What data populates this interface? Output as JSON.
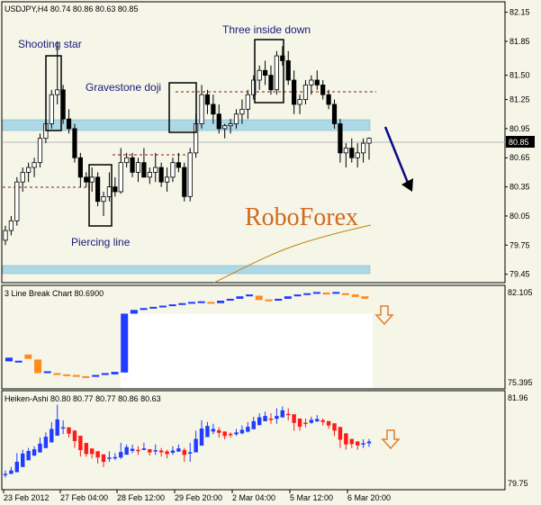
{
  "chart_data": [
    {
      "type": "candlestick",
      "title": "USDJPY,H4 80.74 80.86 80.63 80.85",
      "current_price": "80.85",
      "y_ticks": [
        "82.15",
        "81.85",
        "81.50",
        "81.25",
        "80.95",
        "80.65",
        "80.35",
        "80.05",
        "79.75",
        "79.45"
      ],
      "ylim": [
        79.4,
        82.22
      ],
      "ohlc": [
        [
          79.8,
          79.95,
          79.75,
          79.9
        ],
        [
          79.9,
          80.05,
          79.85,
          80.0
        ],
        [
          80.0,
          80.45,
          79.95,
          80.4
        ],
        [
          80.4,
          80.55,
          80.3,
          80.5
        ],
        [
          80.5,
          80.6,
          80.4,
          80.55
        ],
        [
          80.55,
          80.65,
          80.45,
          80.6
        ],
        [
          80.6,
          80.9,
          80.55,
          80.85
        ],
        [
          80.85,
          81.05,
          80.8,
          81.0
        ],
        [
          81.0,
          81.35,
          80.95,
          81.3
        ],
        [
          81.3,
          81.85,
          81.2,
          81.35
        ],
        [
          81.35,
          81.4,
          81.0,
          81.05
        ],
        [
          81.05,
          81.15,
          80.9,
          80.95
        ],
        [
          80.95,
          81.0,
          80.6,
          80.65
        ],
        [
          80.65,
          80.7,
          80.35,
          80.45
        ],
        [
          80.45,
          80.5,
          80.35,
          80.4
        ],
        [
          80.4,
          80.55,
          80.3,
          80.45
        ],
        [
          80.45,
          80.5,
          80.15,
          80.2
        ],
        [
          80.2,
          80.3,
          80.05,
          80.25
        ],
        [
          80.25,
          80.5,
          80.2,
          80.35
        ],
        [
          80.35,
          80.45,
          80.25,
          80.3
        ],
        [
          80.3,
          80.75,
          80.28,
          80.6
        ],
        [
          80.6,
          80.7,
          80.55,
          80.65
        ],
        [
          80.65,
          80.7,
          80.45,
          80.5
        ],
        [
          80.5,
          80.65,
          80.4,
          80.6
        ],
        [
          80.6,
          80.75,
          80.55,
          80.45
        ],
        [
          80.45,
          80.55,
          80.38,
          80.5
        ],
        [
          80.5,
          80.7,
          80.4,
          80.55
        ],
        [
          80.55,
          80.6,
          80.35,
          80.4
        ],
        [
          80.4,
          80.55,
          80.3,
          80.45
        ],
        [
          80.45,
          80.65,
          80.4,
          80.6
        ],
        [
          80.6,
          80.7,
          80.5,
          80.55
        ],
        [
          80.55,
          80.6,
          80.2,
          80.25
        ],
        [
          80.25,
          80.75,
          80.2,
          80.7
        ],
        [
          80.7,
          81.1,
          80.65,
          81.0
        ],
        [
          81.0,
          81.4,
          80.95,
          81.3
        ],
        [
          81.3,
          81.35,
          81.1,
          81.2
        ],
        [
          81.2,
          81.3,
          81.0,
          81.1
        ],
        [
          81.1,
          81.2,
          80.9,
          80.95
        ],
        [
          80.95,
          81.0,
          80.85,
          80.98
        ],
        [
          80.98,
          81.05,
          80.9,
          81.0
        ],
        [
          81.0,
          81.15,
          80.95,
          81.1
        ],
        [
          81.1,
          81.25,
          81.0,
          81.15
        ],
        [
          81.15,
          81.35,
          81.05,
          81.3
        ],
        [
          81.3,
          81.5,
          81.25,
          81.45
        ],
        [
          81.45,
          81.6,
          81.35,
          81.55
        ],
        [
          81.55,
          81.65,
          81.4,
          81.5
        ],
        [
          81.5,
          81.6,
          81.3,
          81.35
        ],
        [
          81.35,
          81.75,
          81.3,
          81.7
        ],
        [
          81.7,
          81.8,
          81.6,
          81.65
        ],
        [
          81.65,
          81.75,
          81.4,
          81.45
        ],
        [
          81.45,
          81.55,
          81.1,
          81.2
        ],
        [
          81.2,
          81.3,
          81.1,
          81.25
        ],
        [
          81.25,
          81.45,
          81.2,
          81.4
        ],
        [
          81.4,
          81.5,
          81.3,
          81.45
        ],
        [
          81.45,
          81.55,
          81.35,
          81.4
        ],
        [
          81.4,
          81.45,
          81.25,
          81.3
        ],
        [
          81.3,
          81.35,
          81.15,
          81.2
        ],
        [
          81.2,
          81.25,
          80.95,
          81.0
        ],
        [
          81.0,
          81.05,
          80.6,
          80.7
        ],
        [
          80.7,
          80.8,
          80.55,
          80.75
        ],
        [
          80.75,
          80.85,
          80.6,
          80.65
        ],
        [
          80.65,
          80.8,
          80.55,
          80.7
        ],
        [
          80.7,
          80.85,
          80.6,
          80.8
        ],
        [
          80.8,
          80.86,
          80.63,
          80.85
        ]
      ],
      "annotations": [
        "Shooting star",
        "Gravestone doji",
        "Three inside down",
        "Piercing line"
      ],
      "watermark": "RoboForex"
    },
    {
      "type": "line_break",
      "title": "3 Line Break Chart 80.6900",
      "y_ticks": [
        "82.105",
        "75.395"
      ],
      "ylim": [
        75.2,
        82.25
      ],
      "bricks": [
        [
          76.55,
          76.85,
          "up"
        ],
        [
          76.5,
          76.6,
          "up"
        ],
        [
          76.75,
          77.1,
          "down"
        ],
        [
          75.6,
          76.7,
          "down"
        ],
        [
          75.6,
          75.75,
          "up"
        ],
        [
          75.45,
          75.6,
          "down"
        ],
        [
          75.4,
          75.5,
          "down"
        ],
        [
          75.3,
          75.45,
          "down"
        ],
        [
          75.25,
          75.35,
          "down"
        ],
        [
          75.3,
          75.45,
          "up"
        ],
        [
          75.45,
          75.6,
          "up"
        ],
        [
          75.5,
          75.7,
          "up"
        ],
        [
          75.65,
          80.4,
          "up"
        ],
        [
          80.4,
          80.7,
          "up"
        ],
        [
          80.7,
          80.85,
          "up"
        ],
        [
          80.85,
          80.95,
          "up"
        ],
        [
          80.95,
          81.05,
          "up"
        ],
        [
          81.05,
          81.15,
          "up"
        ],
        [
          81.15,
          81.25,
          "up"
        ],
        [
          81.25,
          81.35,
          "up"
        ],
        [
          81.35,
          81.4,
          "up"
        ],
        [
          81.2,
          81.35,
          "down"
        ],
        [
          81.25,
          81.45,
          "up"
        ],
        [
          81.45,
          81.6,
          "up"
        ],
        [
          81.6,
          81.8,
          "up"
        ],
        [
          81.8,
          81.95,
          "up"
        ],
        [
          81.5,
          81.85,
          "down"
        ],
        [
          81.45,
          81.55,
          "down"
        ],
        [
          81.45,
          81.6,
          "up"
        ],
        [
          81.6,
          81.8,
          "up"
        ],
        [
          81.8,
          81.95,
          "up"
        ],
        [
          81.95,
          82.05,
          "up"
        ],
        [
          82.05,
          82.15,
          "up"
        ],
        [
          81.95,
          82.1,
          "down"
        ],
        [
          82.05,
          82.15,
          "up"
        ],
        [
          81.9,
          82.05,
          "down"
        ],
        [
          81.75,
          81.95,
          "down"
        ],
        [
          81.6,
          81.8,
          "down"
        ]
      ]
    },
    {
      "type": "heiken_ashi",
      "title": "Heiken-Ashi 80.80 80.77 80.77 80.86 80.63",
      "y_ticks": [
        "81.96",
        "79.75"
      ],
      "ylim": [
        79.55,
        82.1
      ],
      "x_ticks": [
        "23 Feb 2012",
        "27 Feb 04:00",
        "28 Feb 12:00",
        "29 Feb 20:00",
        "2 Mar 04:00",
        "5 Mar 12:00",
        "6 Mar 20:00"
      ]
    }
  ]
}
